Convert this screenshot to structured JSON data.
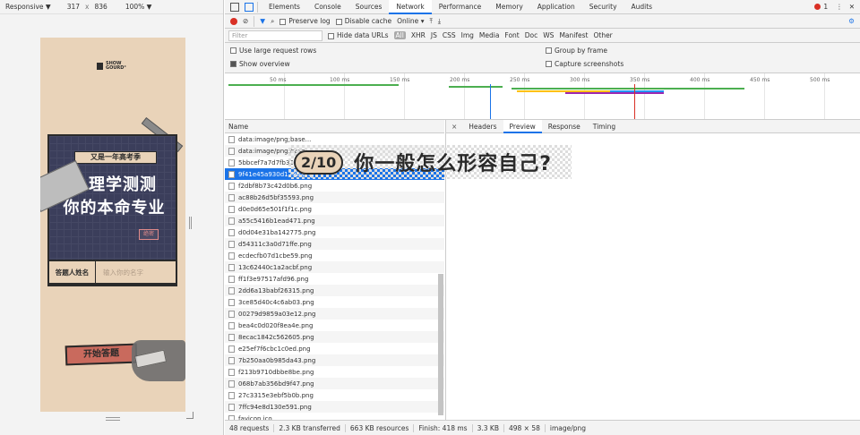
{
  "device": {
    "mode": "Responsive ▼",
    "width": "317",
    "x": "x",
    "height": "836",
    "zoom": "100% ▼"
  },
  "phone": {
    "logo": "SHOW\nGOURD°",
    "tag": "又是一年高考季",
    "title1": "心理学测测",
    "title2": "你的本命专业",
    "stamp": "绝密",
    "name_label": "答题人姓名",
    "name_placeholder": "输入你的名字",
    "start": "开始答题"
  },
  "tabs": [
    "Elements",
    "Console",
    "Sources",
    "Network",
    "Performance",
    "Memory",
    "Application",
    "Security",
    "Audits"
  ],
  "errors": "1",
  "toolbar": {
    "preserve": "Preserve log",
    "disable": "Disable cache",
    "online": "Online"
  },
  "filterbar": {
    "placeholder": "Filter",
    "hide": "Hide data URLs",
    "types": [
      "All",
      "XHR",
      "JS",
      "CSS",
      "Img",
      "Media",
      "Font",
      "Doc",
      "WS",
      "Manifest",
      "Other"
    ]
  },
  "options": {
    "large": "Use large request rows",
    "overview": "Show overview",
    "group": "Group by frame",
    "capture": "Capture screenshots"
  },
  "ticks": [
    "50 ms",
    "100 ms",
    "150 ms",
    "200 ms",
    "250 ms",
    "300 ms",
    "350 ms",
    "400 ms",
    "450 ms",
    "500 ms"
  ],
  "list": {
    "header": "Name",
    "rows": [
      "data:image/png;base...",
      "data:image/png;base...",
      "5bbcef7a7d7fb32a.png",
      "9f41e45a930d129b.png",
      "f2dbf8b73c42d0b6.png",
      "ac88b26d5bf35593.png",
      "d0e0d65e501f1f1c.png",
      "a55c5416b1ead471.png",
      "d0d04e31ba142775.png",
      "d54311c3a0d71ffe.png",
      "ecdecfb07d1cbe59.png",
      "13c62440c1a2acbf.png",
      "ff1f3e97517afd96.png",
      "2dd6a13babf26315.png",
      "3ce85d40c4c6ab03.png",
      "00279d9859a03e12.png",
      "bea4c0d020f8ea4e.png",
      "8ecac1842c562605.png",
      "e25ef7f6cbc1c0ed.png",
      "7b250aa0b985da43.png",
      "f213b9710dbbe8be.png",
      "068b7ab356bd9f47.png",
      "27c3315e3ebf5b0b.png",
      "7ffc94e8d130e591.png",
      "favicon.ico"
    ],
    "selected": 3
  },
  "detail": {
    "close": "×",
    "tabs": [
      "Headers",
      "Preview",
      "Response",
      "Timing"
    ],
    "preview_badge": "2/10",
    "preview_text": "你一般怎么形容自己?"
  },
  "status": [
    "48 requests",
    "2.3 KB transferred",
    "663 KB resources",
    "Finish: 418 ms",
    "3.3 KB",
    "498 × 58",
    "image/png"
  ]
}
